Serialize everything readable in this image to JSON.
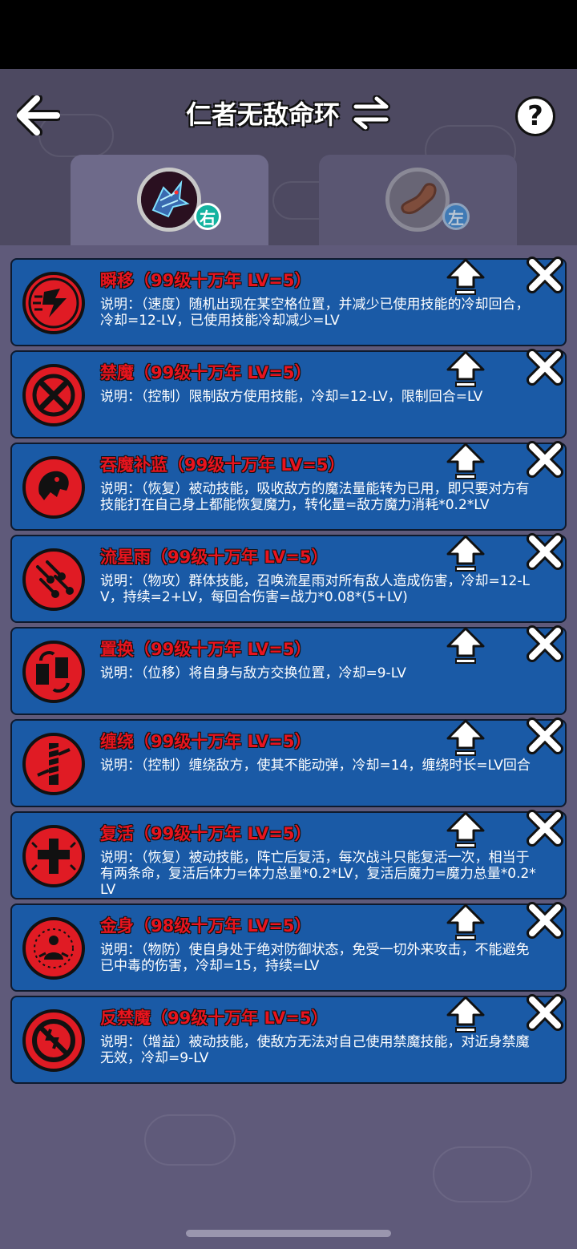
{
  "header": {
    "title": "仁者无敌命环",
    "help_label": "?"
  },
  "tabs": [
    {
      "side": "右",
      "active": true
    },
    {
      "side": "左",
      "active": false
    }
  ],
  "skills": [
    {
      "name": "瞬移（99级十万年 LV=5）",
      "desc": "说明：（速度）随机出现在某空格位置，并减少已使用技能的冷却回合，冷却=12-LV，已使用技能冷却减少=LV",
      "icon": "teleport-icon"
    },
    {
      "name": "禁魔（99级十万年 LV=5）",
      "desc": "说明：（控制）限制敌方使用技能，冷却=12-LV，限制回合=LV",
      "icon": "silence-icon"
    },
    {
      "name": "吞魔补蓝（99级十万年 LV=5）",
      "desc": "说明：（恢复）被动技能，吸收敌方的魔法量能转为已用，即只要对方有技能打在自己身上都能恢复魔力，转化量=敌方魔力消耗*0.2*LV",
      "icon": "mana-devour-icon"
    },
    {
      "name": "流星雨（99级十万年 LV=5）",
      "desc": "说明：（物攻）群体技能，召唤流星雨对所有敌人造成伤害，冷却=12-LV，持续=2+LV，每回合伤害=战力*0.08*(5+LV)",
      "icon": "meteor-shower-icon"
    },
    {
      "name": "置换（99级十万年 LV=5）",
      "desc": "说明：（位移）将自身与敌方交换位置，冷却=9-LV",
      "icon": "swap-position-icon"
    },
    {
      "name": "缠绕（99级十万年 LV=5）",
      "desc": "说明：（控制）缠绕敌方，使其不能动弹，冷却=14，缠绕时长=LV回合",
      "icon": "entangle-icon"
    },
    {
      "name": "复活（99级十万年 LV=5）",
      "desc": "说明：（恢复）被动技能，阵亡后复活，每次战斗只能复活一次，相当于有两条命，复活后体力=体力总量*0.2*LV，复活后魔力=魔力总量*0.2*LV",
      "icon": "revive-icon"
    },
    {
      "name": "金身（98级十万年 LV=5）",
      "desc": "说明：（物防）使自身处于绝对防御状态，免受一切外来攻击，不能避免已中毒的伤害，冷却=15，持续=LV",
      "icon": "golden-body-icon"
    },
    {
      "name": "反禁魔（99级十万年 LV=5）",
      "desc": "说明：（增益）被动技能，使敌方无法对自己使用禁魔技能，对近身禁魔无效，冷却=9-LV",
      "icon": "anti-silence-icon"
    }
  ],
  "colors": {
    "card": "#1a5aa6",
    "skill_name": "#e8141e",
    "icon_red": "#e01b24"
  }
}
